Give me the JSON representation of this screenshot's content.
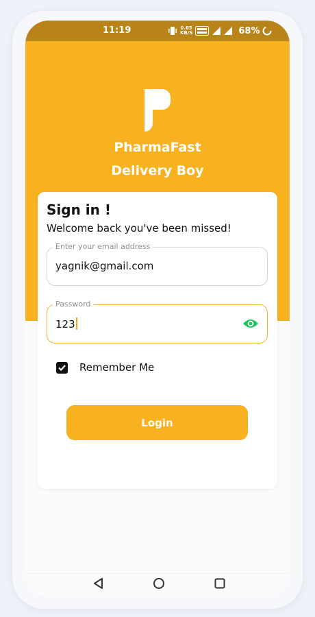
{
  "status_bar": {
    "time": "11:19",
    "net_speed_value": "0.65",
    "net_speed_unit": "KB/S",
    "battery": "68%"
  },
  "brand": {
    "name": "PharmaFast",
    "subtitle": "Delivery Boy"
  },
  "signin": {
    "title": "Sign in !",
    "subtitle": "Welcome back you've been missed!"
  },
  "email_field": {
    "label": "Enter your email address",
    "value": "yagnik@gmail.com"
  },
  "password_field": {
    "label": "Password",
    "value": "123"
  },
  "remember_me": {
    "label": "Remember Me",
    "checked": true
  },
  "login_button": {
    "label": "Login"
  },
  "colors": {
    "accent": "#f8b11f",
    "status_bar": "#b88419",
    "eye_icon": "#22c55e"
  }
}
